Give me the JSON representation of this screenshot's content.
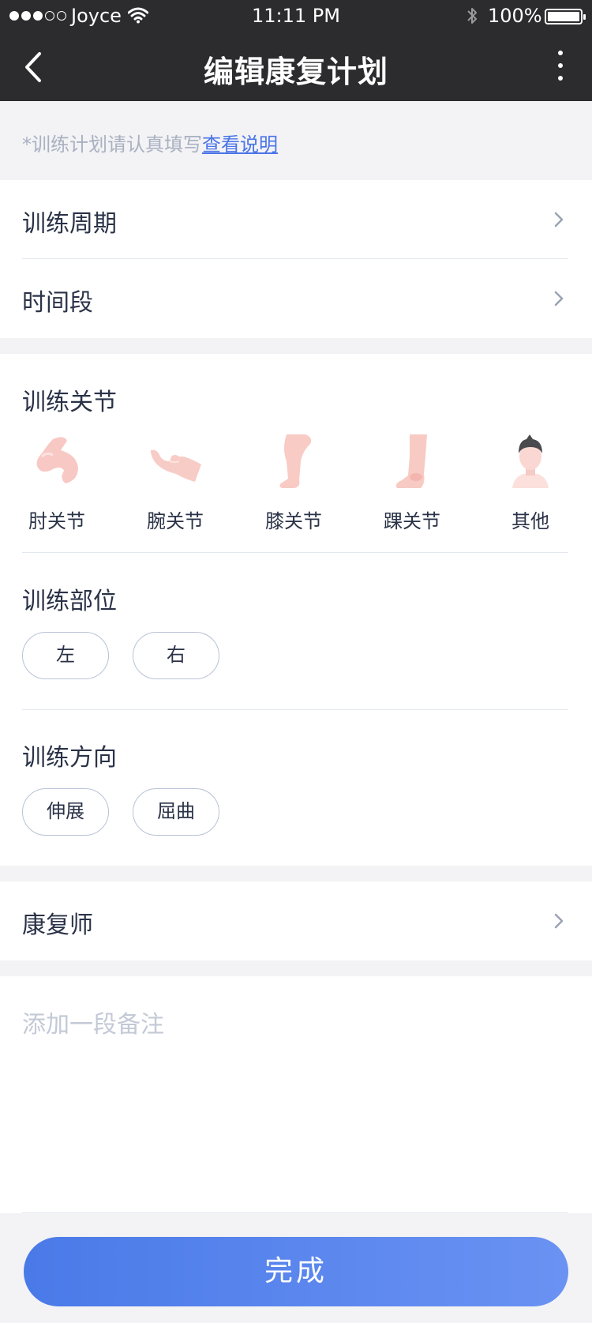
{
  "status_bar": {
    "carrier": "Joyce",
    "time": "11:11 PM",
    "battery": "100%",
    "signal_bars": 3,
    "signal_total": 5,
    "icons": [
      "wifi-icon",
      "bluetooth-icon",
      "battery-icon"
    ]
  },
  "nav": {
    "title": "编辑康复计划",
    "back_icon": "chevron-left-icon",
    "more_icon": "more-vertical-icon"
  },
  "hint": {
    "text": "*训练计划请认真填写",
    "link": "查看说明"
  },
  "rows": {
    "cycle": "训练周期",
    "period": "时间段",
    "therapist": "康复师"
  },
  "joints": {
    "title": "训练关节",
    "items": [
      {
        "label": "肘关节",
        "icon": "elbow-icon"
      },
      {
        "label": "腕关节",
        "icon": "wrist-icon"
      },
      {
        "label": "膝关节",
        "icon": "knee-icon"
      },
      {
        "label": "踝关节",
        "icon": "ankle-icon"
      },
      {
        "label": "其他",
        "icon": "person-icon"
      }
    ]
  },
  "position": {
    "title": "训练部位",
    "options": [
      "左",
      "右"
    ]
  },
  "direction": {
    "title": "训练方向",
    "options": [
      "伸展",
      "屈曲"
    ]
  },
  "note": {
    "placeholder": "添加一段备注"
  },
  "submit": {
    "label": "完成"
  },
  "colors": {
    "accent": "#4a7ae8",
    "nav_bg": "#2c2c2e",
    "text": "#2a3247",
    "muted": "#a9b1c1"
  }
}
